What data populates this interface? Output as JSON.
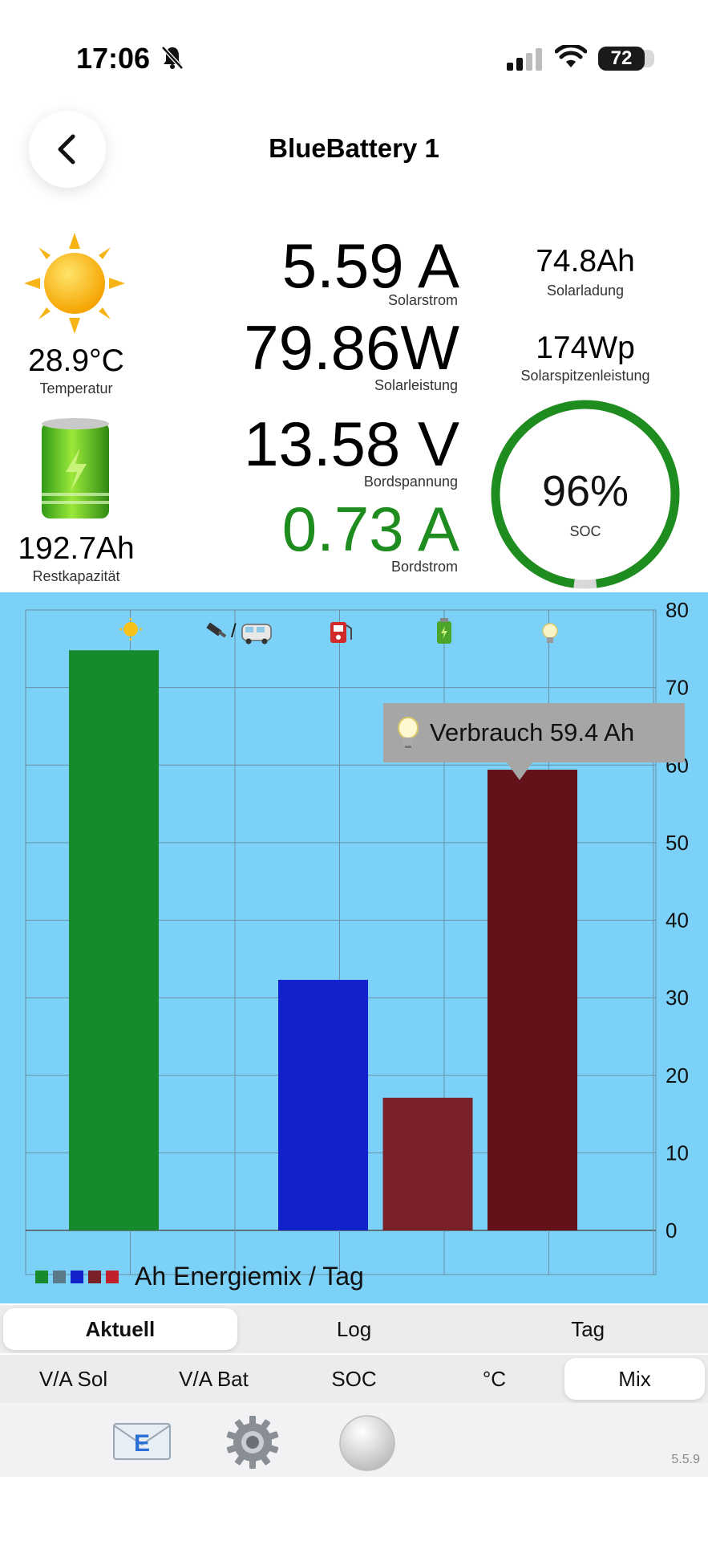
{
  "status": {
    "time": "17:06",
    "battery": "72"
  },
  "header": {
    "title": "BlueBattery 1"
  },
  "left": {
    "temperature": {
      "value": "28.9°C",
      "label": "Temperatur"
    },
    "capacity": {
      "value": "192.7Ah",
      "label": "Restkapazität"
    }
  },
  "readings": {
    "solar_current": {
      "value": "5.59 A",
      "label": "Solarstrom"
    },
    "solar_power": {
      "value": "79.86W",
      "label": "Solarleistung"
    },
    "board_voltage": {
      "value": "13.58 V",
      "label": "Bordspannung"
    },
    "board_current": {
      "value": "0.73 A",
      "label": "Bordstrom",
      "color": "#1e8c1e"
    }
  },
  "right": {
    "solar_charge": {
      "value": "74.8Ah",
      "label": "Solarladung"
    },
    "solar_peak": {
      "value": "174Wp",
      "label": "Solarspitzenleistung"
    },
    "soc": {
      "value": "96%",
      "label": "SOC",
      "fraction": 0.96,
      "color": "#1e8c1e"
    }
  },
  "chart_data": {
    "type": "bar",
    "values": [
      74.8,
      0,
      32.3,
      17.1,
      59.4
    ],
    "colors": [
      "#168a2c",
      "#5a7a8a",
      "#1121cc",
      "#7a2028",
      "#63121a"
    ],
    "category_icons": [
      "sun-icon",
      "plug-van-icon",
      "fuel-icon",
      "battery-icon",
      "lightbulb-icon"
    ],
    "ylim": [
      0,
      80
    ],
    "yticks": [
      "0",
      "10",
      "20",
      "30",
      "40",
      "50",
      "60",
      "70",
      "80"
    ],
    "grid": true,
    "tooltip": "Verbrauch 59.4 Ah",
    "legend": "Ah Energiemix / Tag",
    "legend_colors": [
      "#168a2c",
      "#5a7a8a",
      "#1121cc",
      "#7a2028",
      "#c0202a"
    ]
  },
  "tabs_top": [
    "Aktuell",
    "Log",
    "Tag"
  ],
  "tabs_bottom": [
    "V/A Sol",
    "V/A Bat",
    "SOC",
    "°C",
    "Mix"
  ],
  "toolbar": {
    "version": "5.5.9"
  }
}
